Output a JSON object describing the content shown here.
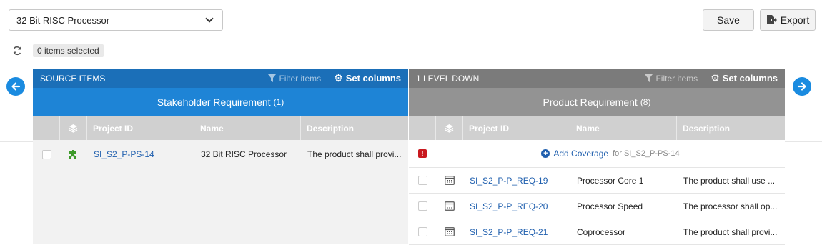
{
  "toolbar": {
    "project_select": "32 Bit RISC Processor",
    "save_label": "Save",
    "export_label": "Export",
    "selection_status": "0 items selected"
  },
  "source_panel": {
    "header": "SOURCE ITEMS",
    "filter_label": "Filter items",
    "set_columns_label": "Set columns",
    "type_title": "Stakeholder Requirement",
    "type_count": "(1)",
    "color": "#1b6fb8",
    "title_color": "#1e84d6",
    "columns": [
      "Project ID",
      "Name",
      "Description"
    ],
    "rows": [
      {
        "project_id": "SI_S2_P-PS-14",
        "name": "32 Bit RISC Processor",
        "description": "The product shall provi..."
      }
    ]
  },
  "target_panel": {
    "header": "1 LEVEL DOWN",
    "filter_label": "Filter items",
    "set_columns_label": "Set columns",
    "type_title": "Product Requirement",
    "type_count": "(8)",
    "color": "#7b7b7b",
    "title_color": "#939393",
    "columns": [
      "Project ID",
      "Name",
      "Description"
    ],
    "add_coverage_label": "Add Coverage",
    "add_coverage_for": "for SI_S2_P-PS-14",
    "rows": [
      {
        "project_id": "SI_S2_P-P_REQ-19",
        "name": "Processor Core 1",
        "description": "The product shall use ..."
      },
      {
        "project_id": "SI_S2_P-P_REQ-20",
        "name": "Processor Speed",
        "description": "The processor shall op..."
      },
      {
        "project_id": "SI_S2_P-P_REQ-21",
        "name": "Coprocessor",
        "description": "The product shall provi..."
      }
    ]
  },
  "icons": {
    "nav_left": "arrow-left-circle-icon",
    "nav_right": "arrow-right-circle-icon",
    "refresh": "refresh-icon",
    "filter": "filter-icon",
    "gear": "gear-icon",
    "layers": "layers-icon",
    "puzzle": "puzzle-icon",
    "document": "document-icon",
    "error": "error-icon",
    "add": "plus-circle-icon",
    "export": "export-file-icon"
  }
}
